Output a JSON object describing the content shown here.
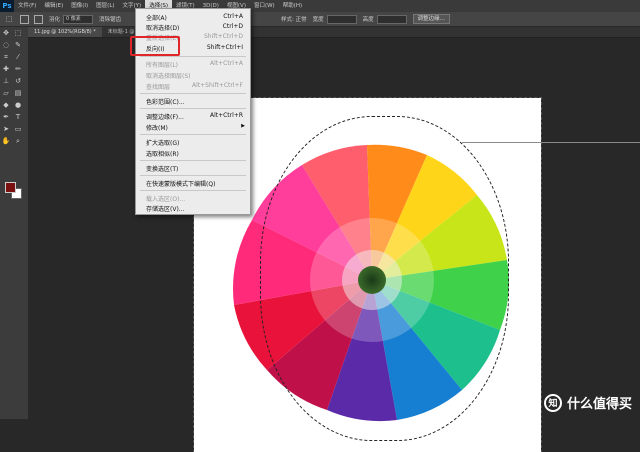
{
  "app": {
    "logo": "Ps"
  },
  "menubar": {
    "items": [
      "文件(F)",
      "编辑(E)",
      "图像(I)",
      "图层(L)",
      "文字(Y)",
      "选择(S)",
      "滤镜(T)",
      "3D(D)",
      "视图(V)",
      "窗口(W)",
      "帮助(H)"
    ]
  },
  "options": {
    "feather_label": "羽化",
    "feather_value": "0 像素",
    "antialias_label": "消除锯齿",
    "style_label": "样式: 正常",
    "width_label": "宽度",
    "height_label": "高度",
    "refine_button": "调整边缘..."
  },
  "document": {
    "tab_active": "11.jpg @ 102%(RGB/8) *",
    "tab_other": "未标题-1 @ 66.7%..."
  },
  "select_menu": {
    "items": [
      {
        "label": "全部(A)",
        "shortcut": "Ctrl+A",
        "enabled": true
      },
      {
        "label": "取消选择(D)",
        "shortcut": "Ctrl+D",
        "enabled": true
      },
      {
        "label": "重新选择(E)",
        "shortcut": "Shift+Ctrl+D",
        "enabled": false
      },
      {
        "label": "反向(I)",
        "shortcut": "Shift+Ctrl+I",
        "enabled": true
      },
      {
        "label": "所有图层(L)",
        "shortcut": "Alt+Ctrl+A",
        "enabled": false
      },
      {
        "label": "取消选择图层(S)",
        "shortcut": "",
        "enabled": false
      },
      {
        "label": "查找图层",
        "shortcut": "Alt+Shift+Ctrl+F",
        "enabled": false
      },
      {
        "label": "色彩范围(C)...",
        "shortcut": "",
        "enabled": true
      },
      {
        "label": "调整边缘(F)...",
        "shortcut": "Alt+Ctrl+R",
        "enabled": true
      },
      {
        "label": "修改(M)",
        "shortcut": "",
        "enabled": true,
        "submenu": true
      },
      {
        "label": "扩大选取(G)",
        "shortcut": "",
        "enabled": true
      },
      {
        "label": "选取相似(R)",
        "shortcut": "",
        "enabled": true
      },
      {
        "label": "变换选区(T)",
        "shortcut": "",
        "enabled": true
      },
      {
        "label": "在快速蒙版模式下编辑(Q)",
        "shortcut": "",
        "enabled": true
      },
      {
        "label": "载入选区(O)...",
        "shortcut": "",
        "enabled": false
      },
      {
        "label": "存储选区(V)...",
        "shortcut": "",
        "enabled": true
      }
    ]
  },
  "watermark": {
    "logo": "知",
    "text": "什么值得买"
  },
  "colors": {
    "foreground": "#7a1010",
    "background": "#ffffff",
    "highlight": "#e0262a"
  }
}
